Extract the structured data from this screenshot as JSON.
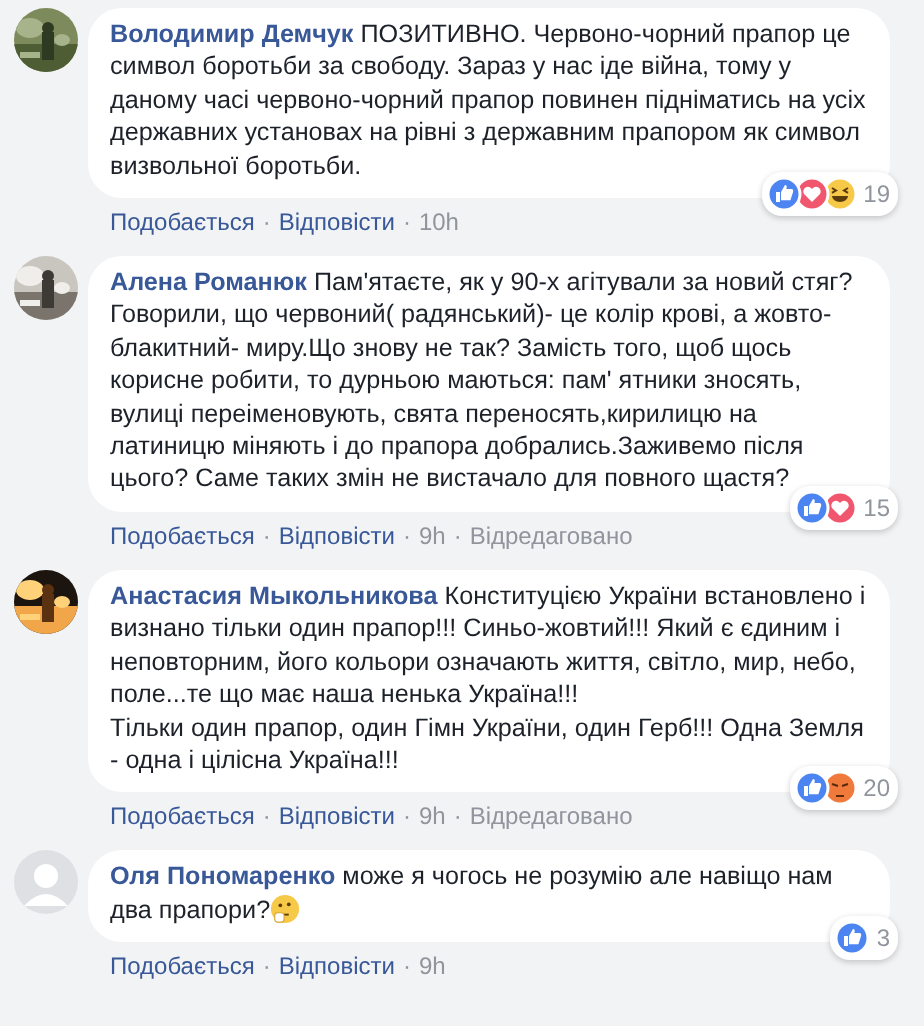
{
  "comments": [
    {
      "avatar": {
        "kind": "picture"
      },
      "author": "Володимир Демчук",
      "text": "ПОЗИТИВНО. Червоно-чорний прапор це символ боротьби за свободу. Зараз у нас іде війна, тому у даному часі червоно-чорний прапор повинен підніматись на усіх державних установах на рівні з державним прапором як символ визвольної боротьби.",
      "trailing_emoji": false,
      "reactions": [
        {
          "kind": "like"
        },
        {
          "kind": "love"
        },
        {
          "kind": "haha"
        }
      ],
      "reaction_count": "19",
      "meta": [
        {
          "kind": "link",
          "text": "Подобається"
        },
        {
          "kind": "sep",
          "text": "·"
        },
        {
          "kind": "link",
          "text": "Відповісти"
        },
        {
          "kind": "sep",
          "text": "·"
        },
        {
          "kind": "time",
          "text": "10h"
        }
      ]
    },
    {
      "avatar": {
        "kind": "picture"
      },
      "author": "Алена Романюк",
      "text": "Пам'ятаєте, як у 90-х агітували за новий стяг? Говорили, що червоний( радянський)- це колір крові, а жовто-блакитний- миру.Що знову не так? Замість того, щоб щось корисне робити, то дурньою маються: пам' ятники зносять, вулиці переіменовують, свята переносять,кирилицю на латиницю міняють і до прапора добрались.Заживемо після цього? Саме таких змін не вистачало для повного щастя?",
      "trailing_emoji": false,
      "reactions": [
        {
          "kind": "like"
        },
        {
          "kind": "love"
        }
      ],
      "reaction_count": "15",
      "meta": [
        {
          "kind": "link",
          "text": "Подобається"
        },
        {
          "kind": "sep",
          "text": "·"
        },
        {
          "kind": "link",
          "text": "Відповісти"
        },
        {
          "kind": "sep",
          "text": "·"
        },
        {
          "kind": "time",
          "text": "9h"
        },
        {
          "kind": "sep",
          "text": "·"
        },
        {
          "kind": "edited",
          "text": "Відредаговано"
        }
      ]
    },
    {
      "avatar": {
        "kind": "picture"
      },
      "author": "Анастасия Мыкольникова",
      "text": "Конституцією України встановлено і визнано тільки один прапор!!! Синьо-жовтий!!! Який є єдиним і неповторним, його кольори означають життя, світло, мир, небо, поле...те що має наша ненька Україна!!!\nТільки один прапор, один Гімн України, один Герб!!! Одна Земля - одна і цілісна Україна!!!",
      "trailing_emoji": false,
      "reactions": [
        {
          "kind": "like"
        },
        {
          "kind": "angry"
        }
      ],
      "reaction_count": "20",
      "meta": [
        {
          "kind": "link",
          "text": "Подобається"
        },
        {
          "kind": "sep",
          "text": "·"
        },
        {
          "kind": "link",
          "text": "Відповісти"
        },
        {
          "kind": "sep",
          "text": "·"
        },
        {
          "kind": "time",
          "text": "9h"
        },
        {
          "kind": "sep",
          "text": "·"
        },
        {
          "kind": "edited",
          "text": "Відредаговано"
        }
      ]
    },
    {
      "avatar": {
        "kind": "default"
      },
      "author": "Оля Пономаренко",
      "text": "може я чогось не розумію але навіщо нам два прапори?",
      "trailing_emoji": true,
      "reactions": [
        {
          "kind": "like"
        }
      ],
      "reaction_count": "3",
      "meta": [
        {
          "kind": "link",
          "text": "Подобається"
        },
        {
          "kind": "sep",
          "text": "·"
        },
        {
          "kind": "link",
          "text": "Відповісти"
        },
        {
          "kind": "sep",
          "text": "·"
        },
        {
          "kind": "time",
          "text": "9h"
        }
      ]
    }
  ]
}
